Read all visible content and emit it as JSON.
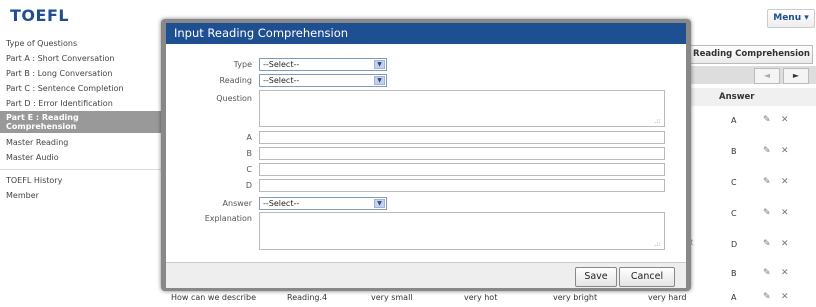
{
  "app": {
    "logo": "TOEFL",
    "menu_label": "Menu ▾"
  },
  "sidebar": {
    "group1": [
      {
        "label": "Type of Questions"
      },
      {
        "label": "Part A : Short Conversation"
      },
      {
        "label": "Part B : Long Conversation"
      },
      {
        "label": "Part C : Sentence Completion"
      },
      {
        "label": "Part D : Error Identification"
      }
    ],
    "active_line1": "Part E : Reading",
    "active_line2": "Comprehension",
    "group2": [
      {
        "label": "Master Reading"
      },
      {
        "label": "Master Audio"
      }
    ],
    "group3": [
      {
        "label": "TOEFL History"
      },
      {
        "label": "Member"
      }
    ]
  },
  "background": {
    "add_button_label": "d Reading Comprehension",
    "pager_prev": "◄",
    "pager_next": "►",
    "answer_header": "Answer",
    "answers": [
      "A",
      "B",
      "C",
      "C",
      "D",
      "B"
    ],
    "side_fragments": [
      "/",
      "e",
      "st"
    ],
    "edit_icon": "✎",
    "delete_icon": "✕",
    "bottom_row": {
      "question": "How can we describe",
      "reading": "Reading.4",
      "a": "very small",
      "b": "very hot",
      "c": "very bright",
      "d": "very hard",
      "answer": "A"
    }
  },
  "modal": {
    "title": "Input Reading Comprehension",
    "labels": {
      "type": "Type",
      "reading": "Reading",
      "question": "Question",
      "a": "A",
      "b": "B",
      "c": "C",
      "d": "D",
      "answer": "Answer",
      "explanation": "Explanation"
    },
    "type_value": "--Select--",
    "reading_value": "--Select--",
    "answer_value": "--Select--",
    "select_arrow": "▼",
    "grip": ".::",
    "save_label": "Save",
    "cancel_label": "Cancel"
  }
}
